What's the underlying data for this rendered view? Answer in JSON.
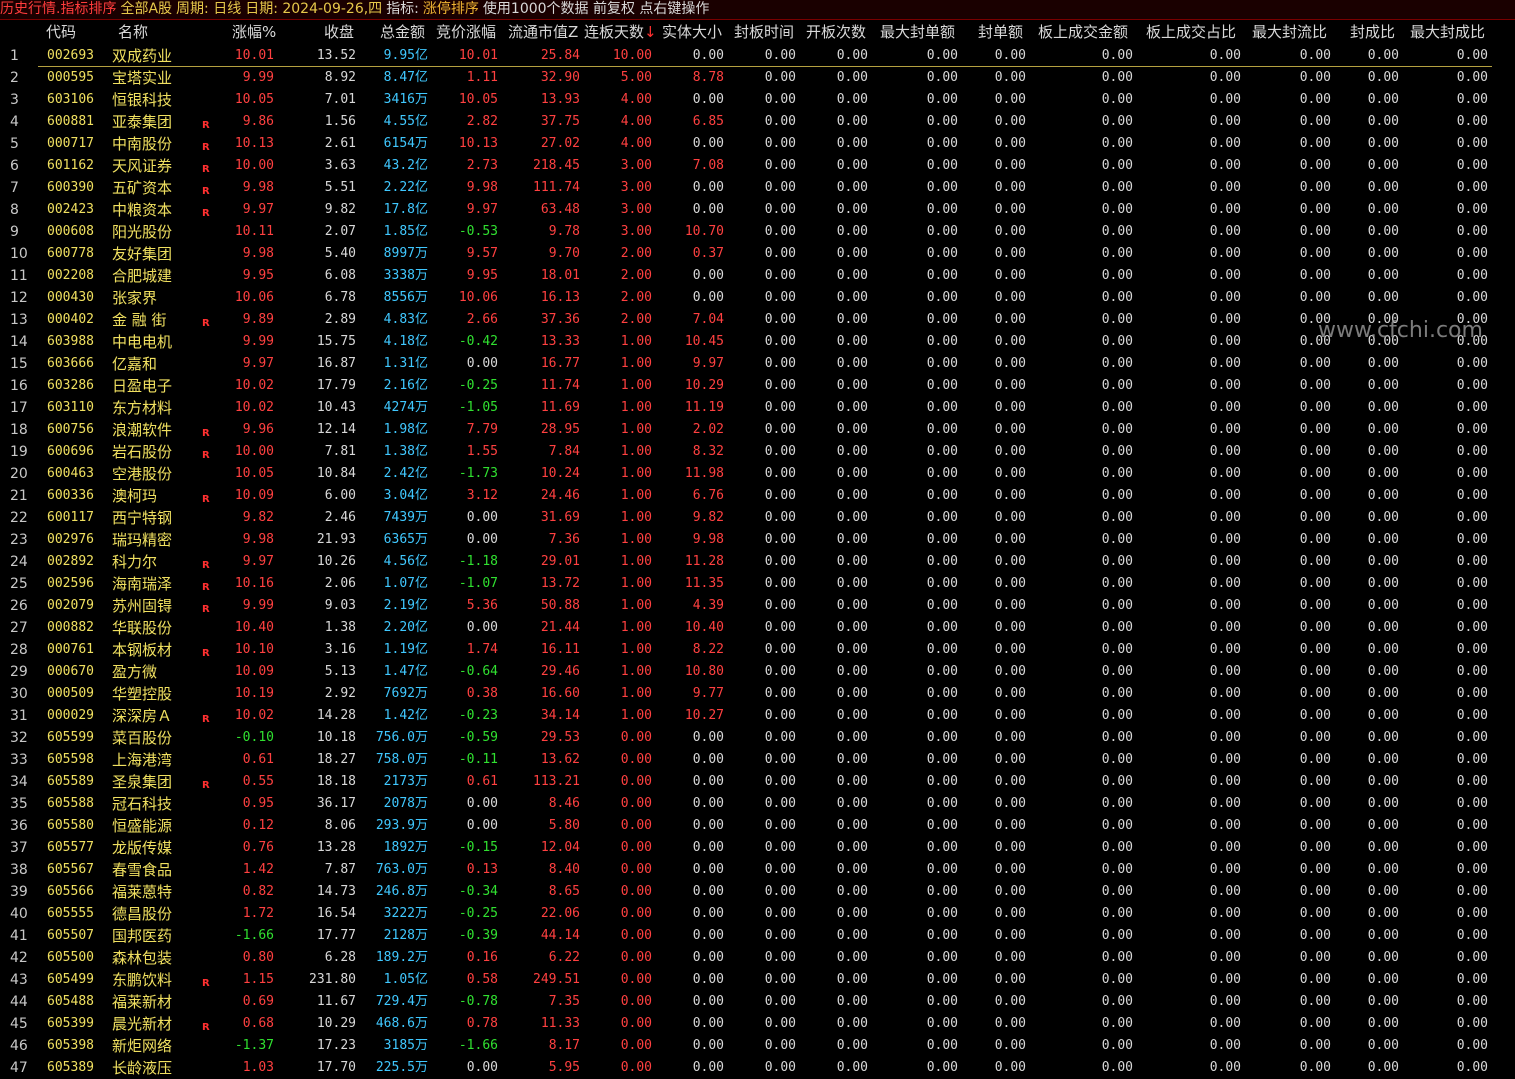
{
  "title": {
    "segments": [
      {
        "text": "历史行情.指标排序",
        "color": "red"
      },
      {
        "text": "全部A股",
        "color": "yellow"
      },
      {
        "text": "周期: 日线",
        "color": "yellow"
      },
      {
        "text": "日期: 2024-09-26,四",
        "color": "yellow"
      },
      {
        "text": "指标:",
        "color": "white"
      },
      {
        "text": "涨停排序",
        "color": "orange"
      },
      {
        "text": "使用1000个数据 前复权 点右键操作",
        "color": "white"
      }
    ]
  },
  "columns": {
    "code": "代码",
    "name": "名称",
    "chg": "涨幅%",
    "close": "收盘",
    "amount": "总金额",
    "bid": "竞价涨幅",
    "cap": "流通市值Z",
    "days": "连板天数",
    "sort_arrow": "↓",
    "body": "实体大小",
    "seal_time": "封板时间",
    "open_count": "开板次数",
    "max_seal": "最大封单额",
    "seal_amt": "封单额",
    "board_amt": "板上成交金额",
    "board_ratio": "板上成交占比",
    "max_seal_float": "最大封流比",
    "seal_ratio": "封成比",
    "max_seal_ratio": "最大封成比"
  },
  "zero_value": "0.00",
  "selected_row": 1,
  "colors": {
    "up": "#ff4040",
    "down": "#30e030",
    "flat": "#d8d8d8",
    "code": "#f0e060",
    "amount": "#40c8ff"
  },
  "rows": [
    [
      "1",
      "002693",
      "双成药业",
      "",
      "10.01",
      "13.52",
      "9.95",
      "亿",
      "10.01",
      "25.84",
      "10.00",
      "0.00"
    ],
    [
      "2",
      "000595",
      "宝塔实业",
      "",
      "9.99",
      "8.92",
      "8.47",
      "亿",
      "1.11",
      "32.90",
      "5.00",
      "8.78"
    ],
    [
      "3",
      "603106",
      "恒银科技",
      "",
      "10.05",
      "7.01",
      "3416",
      "万",
      "10.05",
      "13.93",
      "4.00",
      "0.00"
    ],
    [
      "4",
      "600881",
      "亚泰集团",
      "R",
      "9.86",
      "1.56",
      "4.55",
      "亿",
      "2.82",
      "37.75",
      "4.00",
      "6.85"
    ],
    [
      "5",
      "000717",
      "中南股份",
      "R",
      "10.13",
      "2.61",
      "6154",
      "万",
      "10.13",
      "27.02",
      "4.00",
      "0.00"
    ],
    [
      "6",
      "601162",
      "天风证券",
      "R",
      "10.00",
      "3.63",
      "43.2",
      "亿",
      "2.73",
      "218.45",
      "3.00",
      "7.08"
    ],
    [
      "7",
      "600390",
      "五矿资本",
      "R",
      "9.98",
      "5.51",
      "2.22",
      "亿",
      "9.98",
      "111.74",
      "3.00",
      "0.00"
    ],
    [
      "8",
      "002423",
      "中粮资本",
      "R",
      "9.97",
      "9.82",
      "17.8",
      "亿",
      "9.97",
      "63.48",
      "3.00",
      "0.00"
    ],
    [
      "9",
      "000608",
      "阳光股份",
      "",
      "10.11",
      "2.07",
      "1.85",
      "亿",
      "-0.53",
      "9.78",
      "3.00",
      "10.70"
    ],
    [
      "10",
      "600778",
      "友好集团",
      "",
      "9.98",
      "5.40",
      "8997",
      "万",
      "9.57",
      "9.70",
      "2.00",
      "0.37"
    ],
    [
      "11",
      "002208",
      "合肥城建",
      "",
      "9.95",
      "6.08",
      "3338",
      "万",
      "9.95",
      "18.01",
      "2.00",
      "0.00"
    ],
    [
      "12",
      "000430",
      "张家界",
      "",
      "10.06",
      "6.78",
      "8556",
      "万",
      "10.06",
      "16.13",
      "2.00",
      "0.00"
    ],
    [
      "13",
      "000402",
      "金 融 街",
      "R",
      "9.89",
      "2.89",
      "4.83",
      "亿",
      "2.66",
      "37.36",
      "2.00",
      "7.04"
    ],
    [
      "14",
      "603988",
      "中电电机",
      "",
      "9.99",
      "15.75",
      "4.18",
      "亿",
      "-0.42",
      "13.33",
      "1.00",
      "10.45"
    ],
    [
      "15",
      "603666",
      "亿嘉和",
      "",
      "9.97",
      "16.87",
      "1.31",
      "亿",
      "0.00",
      "16.77",
      "1.00",
      "9.97"
    ],
    [
      "16",
      "603286",
      "日盈电子",
      "",
      "10.02",
      "17.79",
      "2.16",
      "亿",
      "-0.25",
      "11.74",
      "1.00",
      "10.29"
    ],
    [
      "17",
      "603110",
      "东方材料",
      "",
      "10.02",
      "10.43",
      "4274",
      "万",
      "-1.05",
      "11.69",
      "1.00",
      "11.19"
    ],
    [
      "18",
      "600756",
      "浪潮软件",
      "R",
      "9.96",
      "12.14",
      "1.98",
      "亿",
      "7.79",
      "28.95",
      "1.00",
      "2.02"
    ],
    [
      "19",
      "600696",
      "岩石股份",
      "R",
      "10.00",
      "7.81",
      "1.38",
      "亿",
      "1.55",
      "7.84",
      "1.00",
      "8.32"
    ],
    [
      "20",
      "600463",
      "空港股份",
      "",
      "10.05",
      "10.84",
      "2.42",
      "亿",
      "-1.73",
      "10.24",
      "1.00",
      "11.98"
    ],
    [
      "21",
      "600336",
      "澳柯玛",
      "R",
      "10.09",
      "6.00",
      "3.04",
      "亿",
      "3.12",
      "24.46",
      "1.00",
      "6.76"
    ],
    [
      "22",
      "600117",
      "西宁特钢",
      "",
      "9.82",
      "2.46",
      "7439",
      "万",
      "0.00",
      "31.69",
      "1.00",
      "9.82"
    ],
    [
      "23",
      "002976",
      "瑞玛精密",
      "",
      "9.98",
      "21.93",
      "6365",
      "万",
      "0.00",
      "7.36",
      "1.00",
      "9.98"
    ],
    [
      "24",
      "002892",
      "科力尔",
      "R",
      "9.97",
      "10.26",
      "4.56",
      "亿",
      "-1.18",
      "29.01",
      "1.00",
      "11.28"
    ],
    [
      "25",
      "002596",
      "海南瑞泽",
      "R",
      "10.16",
      "2.06",
      "1.07",
      "亿",
      "-1.07",
      "13.72",
      "1.00",
      "11.35"
    ],
    [
      "26",
      "002079",
      "苏州固锝",
      "R",
      "9.99",
      "9.03",
      "2.19",
      "亿",
      "5.36",
      "50.88",
      "1.00",
      "4.39"
    ],
    [
      "27",
      "000882",
      "华联股份",
      "",
      "10.40",
      "1.38",
      "2.20",
      "亿",
      "0.00",
      "21.44",
      "1.00",
      "10.40"
    ],
    [
      "28",
      "000761",
      "本钢板材",
      "R",
      "10.10",
      "3.16",
      "1.19",
      "亿",
      "1.74",
      "16.11",
      "1.00",
      "8.22"
    ],
    [
      "29",
      "000670",
      "盈方微",
      "",
      "10.09",
      "5.13",
      "1.47",
      "亿",
      "-0.64",
      "29.46",
      "1.00",
      "10.80"
    ],
    [
      "30",
      "000509",
      "华塑控股",
      "",
      "10.19",
      "2.92",
      "7692",
      "万",
      "0.38",
      "16.60",
      "1.00",
      "9.77"
    ],
    [
      "31",
      "000029",
      "深深房Ａ",
      "R",
      "10.02",
      "14.28",
      "1.42",
      "亿",
      "-0.23",
      "34.14",
      "1.00",
      "10.27"
    ],
    [
      "32",
      "605599",
      "菜百股份",
      "",
      "-0.10",
      "10.18",
      "756.0",
      "万",
      "-0.59",
      "29.53",
      "0.00",
      "0.00"
    ],
    [
      "33",
      "605598",
      "上海港湾",
      "",
      "0.61",
      "18.27",
      "758.0",
      "万",
      "-0.11",
      "13.62",
      "0.00",
      "0.00"
    ],
    [
      "34",
      "605589",
      "圣泉集团",
      "R",
      "0.55",
      "18.18",
      "2173",
      "万",
      "0.61",
      "113.21",
      "0.00",
      "0.00"
    ],
    [
      "35",
      "605588",
      "冠石科技",
      "",
      "0.95",
      "36.17",
      "2078",
      "万",
      "0.00",
      "8.46",
      "0.00",
      "0.00"
    ],
    [
      "36",
      "605580",
      "恒盛能源",
      "",
      "0.12",
      "8.06",
      "293.9",
      "万",
      "0.00",
      "5.80",
      "0.00",
      "0.00"
    ],
    [
      "37",
      "605577",
      "龙版传媒",
      "",
      "0.76",
      "13.28",
      "1892",
      "万",
      "-0.15",
      "12.04",
      "0.00",
      "0.00"
    ],
    [
      "38",
      "605567",
      "春雪食品",
      "",
      "1.42",
      "7.87",
      "763.0",
      "万",
      "0.13",
      "8.40",
      "0.00",
      "0.00"
    ],
    [
      "39",
      "605566",
      "福莱蒽特",
      "",
      "0.82",
      "14.73",
      "246.8",
      "万",
      "-0.34",
      "8.65",
      "0.00",
      "0.00"
    ],
    [
      "40",
      "605555",
      "德昌股份",
      "",
      "1.72",
      "16.54",
      "3222",
      "万",
      "-0.25",
      "22.06",
      "0.00",
      "0.00"
    ],
    [
      "41",
      "605507",
      "国邦医药",
      "",
      "-1.66",
      "17.77",
      "2128",
      "万",
      "-0.39",
      "44.14",
      "0.00",
      "0.00"
    ],
    [
      "42",
      "605500",
      "森林包装",
      "",
      "0.80",
      "6.28",
      "189.2",
      "万",
      "0.16",
      "6.22",
      "0.00",
      "0.00"
    ],
    [
      "43",
      "605499",
      "东鹏饮料",
      "R",
      "1.15",
      "231.80",
      "1.05",
      "亿",
      "0.58",
      "249.51",
      "0.00",
      "0.00"
    ],
    [
      "44",
      "605488",
      "福莱新材",
      "",
      "0.69",
      "11.67",
      "729.4",
      "万",
      "-0.78",
      "7.35",
      "0.00",
      "0.00"
    ],
    [
      "45",
      "605399",
      "晨光新材",
      "R",
      "0.68",
      "10.29",
      "468.6",
      "万",
      "0.78",
      "11.33",
      "0.00",
      "0.00"
    ],
    [
      "46",
      "605398",
      "新炬网络",
      "",
      "-1.37",
      "17.23",
      "3185",
      "万",
      "-1.66",
      "8.17",
      "0.00",
      "0.00"
    ],
    [
      "47",
      "605389",
      "长龄液压",
      "",
      "1.03",
      "17.70",
      "225.5",
      "万",
      "0.00",
      "5.95",
      "0.00",
      "0.00"
    ]
  ],
  "watermark": "www.cfchi.com"
}
